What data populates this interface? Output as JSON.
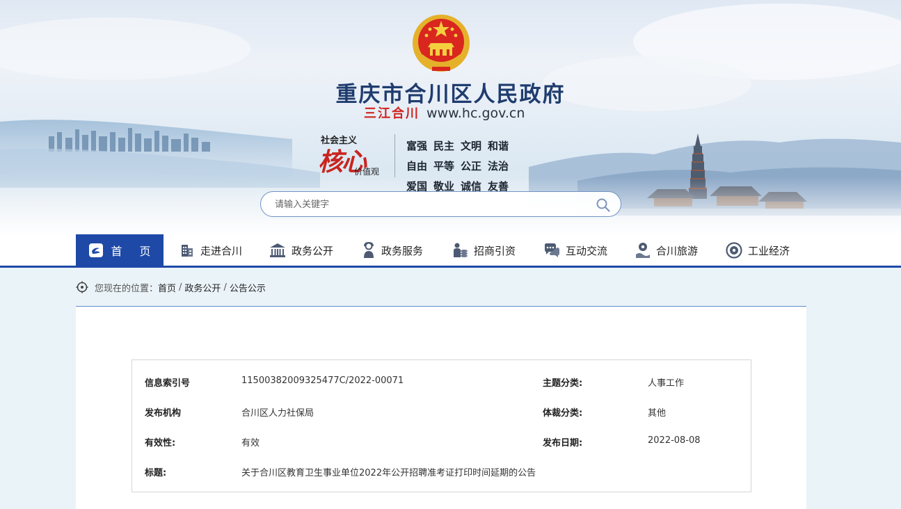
{
  "site": {
    "title": "重庆市合川区人民政府",
    "motto": "三江合川",
    "url": "www.hc.gov.cn"
  },
  "core_values": {
    "top": "社会主义",
    "big": "核心",
    "small": "价值观",
    "values": [
      "富强",
      "民主",
      "文明",
      "和谐",
      "自由",
      "平等",
      "公正",
      "法治",
      "爱国",
      "敬业",
      "诚信",
      "友善"
    ]
  },
  "search": {
    "placeholder": "请输入关键字",
    "icon": "search-icon"
  },
  "nav": [
    {
      "label": "首 页",
      "icon": "home-icon",
      "active": true
    },
    {
      "label": "走进合川",
      "icon": "building-icon"
    },
    {
      "label": "政务公开",
      "icon": "government-hall-icon"
    },
    {
      "label": "政务服务",
      "icon": "service-person-icon"
    },
    {
      "label": "招商引资",
      "icon": "investment-icon"
    },
    {
      "label": "互动交流",
      "icon": "chat-icon"
    },
    {
      "label": "合川旅游",
      "icon": "tourism-icon"
    },
    {
      "label": "工业经济",
      "icon": "industry-icon"
    }
  ],
  "breadcrumb": {
    "prefix": "您现在的位置：",
    "items": [
      "首页",
      "政务公开",
      "公告公示"
    ],
    "separator": "/"
  },
  "info": {
    "index_label": "信息索引号",
    "index_value": "11500382009325477C/2022-00071",
    "topic_label": "主题分类:",
    "topic_value": "人事工作",
    "publisher_label": "发布机构",
    "publisher_value": "合川区人力社保局",
    "genre_label": "体裁分类:",
    "genre_value": "其他",
    "validity_label": "有效性:",
    "validity_value": "有效",
    "date_label": "发布日期:",
    "date_value": "2022-08-08",
    "title_label": "标题:",
    "title_value": "关于合川区教育卫生事业单位2022年公开招聘准考证打印时间延期的公告"
  },
  "colors": {
    "nav_blue": "#1e49a6",
    "title_navy": "#1f3c6e",
    "motto_red": "#d0241f",
    "page_bg": "#eaf3f8"
  }
}
